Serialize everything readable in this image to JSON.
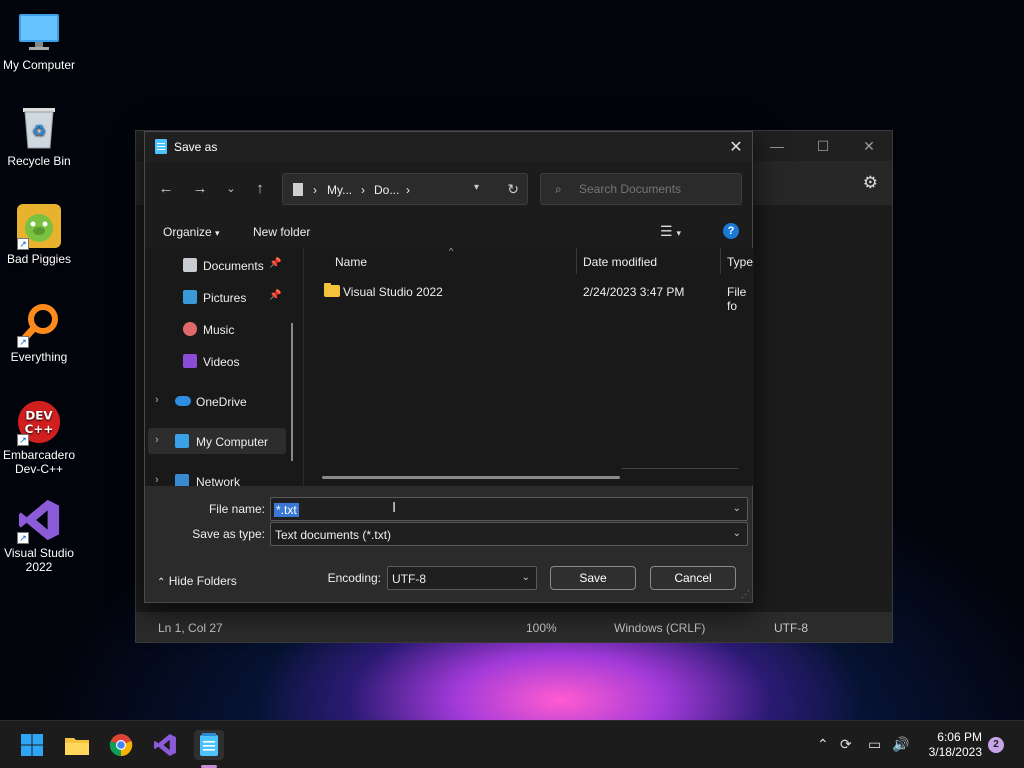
{
  "desktop": {
    "icons": [
      {
        "label": "My Computer"
      },
      {
        "label": "Recycle Bin"
      },
      {
        "label": "Bad Piggies"
      },
      {
        "label": "Everything"
      },
      {
        "label": "Embarcadero Dev-C++"
      },
      {
        "label": "Visual Studio 2022"
      }
    ]
  },
  "notepad": {
    "status": {
      "position": "Ln 1, Col 27",
      "zoom": "100%",
      "line_ending": "Windows (CRLF)",
      "encoding": "UTF-8"
    }
  },
  "dialog": {
    "title": "Save as",
    "address": {
      "crumb1": "My...",
      "crumb2": "Do..."
    },
    "search_placeholder": "Search Documents",
    "commands": {
      "organize": "Organize",
      "new_folder": "New folder"
    },
    "nav": [
      {
        "label": "Documents"
      },
      {
        "label": "Pictures"
      },
      {
        "label": "Music"
      },
      {
        "label": "Videos"
      },
      {
        "label": "OneDrive"
      },
      {
        "label": "My Computer"
      },
      {
        "label": "Network"
      }
    ],
    "columns": {
      "name": "Name",
      "date": "Date modified",
      "type": "Type"
    },
    "files": [
      {
        "name": "Visual Studio 2022",
        "date": "2/24/2023 3:47 PM",
        "type": "File fo"
      }
    ],
    "file_name_label": "File name:",
    "file_name_value": "*.txt",
    "save_type_label": "Save as type:",
    "save_type_value": "Text documents (*.txt)",
    "encoding_label": "Encoding:",
    "encoding_value": "UTF-8",
    "save_label": "Save",
    "cancel_label": "Cancel",
    "hide_folders_label": "Hide Folders"
  },
  "taskbar": {
    "time": "6:06 PM",
    "date": "3/18/2023",
    "notifications": "2"
  },
  "colors": {
    "accent": "#3a78d6",
    "folder": "#f4c23c",
    "help": "#1a7bd6"
  }
}
